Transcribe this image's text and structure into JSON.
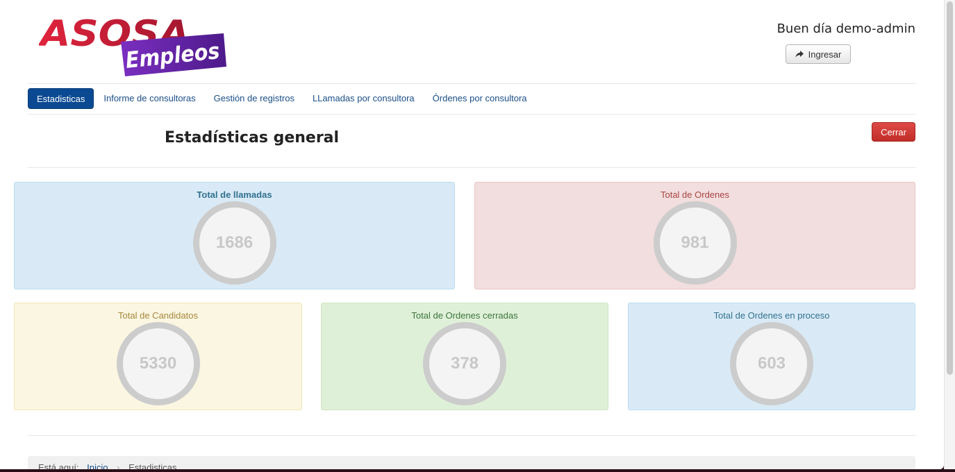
{
  "brand": {
    "logo_top": "ASOSA",
    "logo_bottom": "Empleos",
    "primary": "#c41e3a",
    "secondary": "#6a2ca8"
  },
  "header": {
    "greeting": "Buen día demo-admin",
    "login_label": "Ingresar",
    "login_icon": "share-arrow-icon"
  },
  "nav": {
    "items": [
      {
        "label": "Estadisticas",
        "active": true
      },
      {
        "label": "Informe de consultoras"
      },
      {
        "label": "Gestión de registros"
      },
      {
        "label": "LLamadas por consultora"
      },
      {
        "label": "Órdenes por consultora"
      }
    ]
  },
  "main": {
    "title": "Estadísticas general",
    "close_label": "Cerrar",
    "stats": [
      {
        "label": "Total de llamadas",
        "value": "1686",
        "color": "#d9eaf6"
      },
      {
        "label": "Total de Ordenes",
        "value": "981",
        "color": "#f2dede"
      },
      {
        "label": "Total de Candidatos",
        "value": "5330",
        "color": "#faf6e1"
      },
      {
        "label": "Total de Ordenes cerradas",
        "value": "378",
        "color": "#dff0d8"
      },
      {
        "label": "Total de Ordenes en proceso",
        "value": "603",
        "color": "#d9eaf6"
      }
    ]
  },
  "breadcrumb": {
    "prefix": "Está aquí:",
    "home": "Inicio",
    "current": "Estadisticas"
  }
}
